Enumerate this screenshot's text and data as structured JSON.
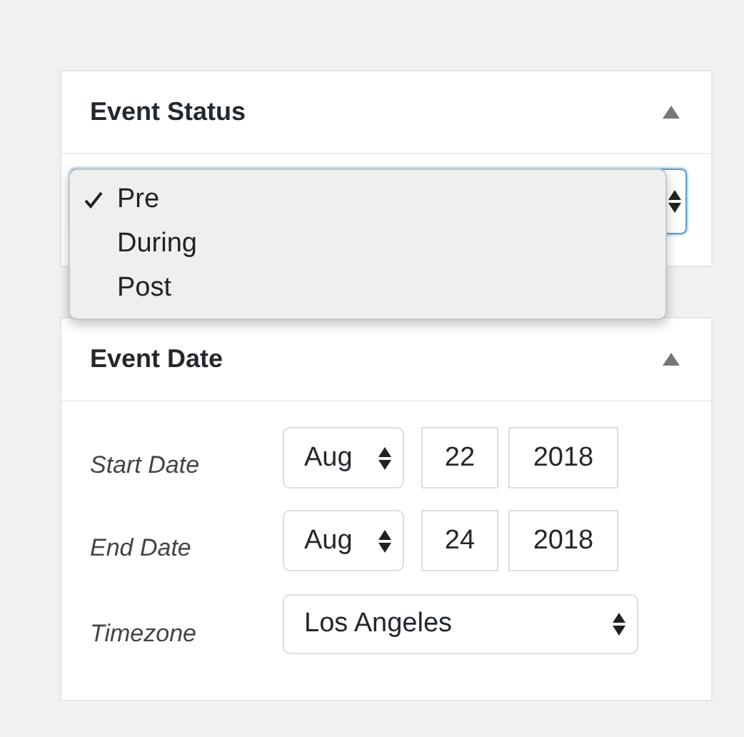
{
  "event_status": {
    "title": "Event Status",
    "expanded": true,
    "dropdown_open": true,
    "options": [
      {
        "label": "Pre",
        "selected": true
      },
      {
        "label": "During",
        "selected": false
      },
      {
        "label": "Post",
        "selected": false
      }
    ]
  },
  "event_date": {
    "title": "Event Date",
    "expanded": true,
    "rows": [
      {
        "label": "Start Date",
        "kind": "date",
        "month": "Aug",
        "day": "22",
        "year": "2018"
      },
      {
        "label": "End Date",
        "kind": "date",
        "month": "Aug",
        "day": "24",
        "year": "2018"
      },
      {
        "label": "Timezone",
        "kind": "select",
        "value": "Los Angeles"
      }
    ]
  }
}
